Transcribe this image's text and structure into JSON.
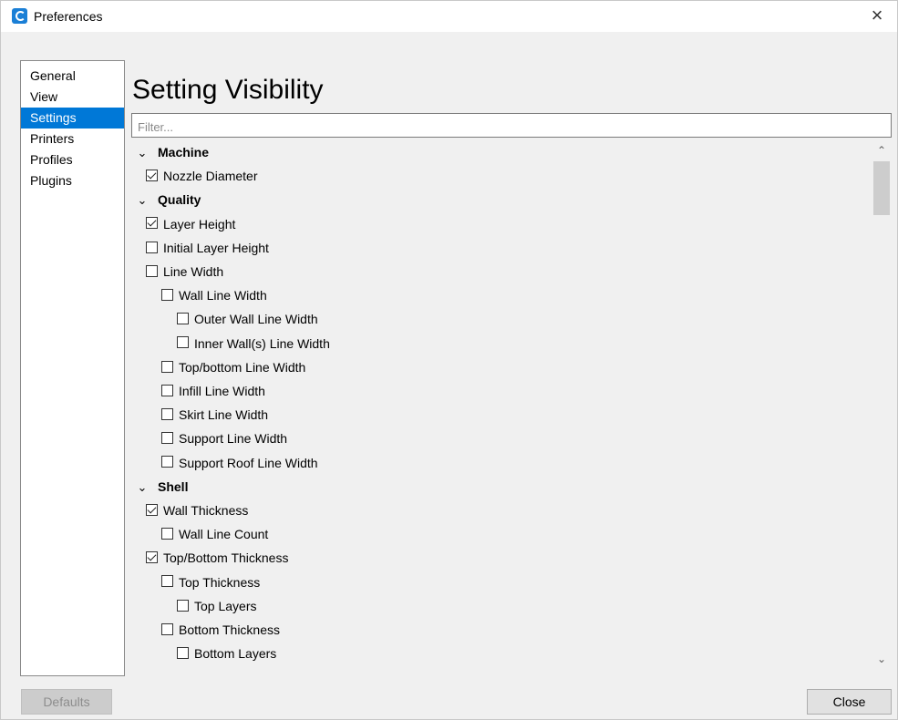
{
  "window": {
    "title": "Preferences",
    "close_glyph": "×"
  },
  "nav": {
    "items": [
      {
        "label": "General",
        "selected": false
      },
      {
        "label": "View",
        "selected": false
      },
      {
        "label": "Settings",
        "selected": true
      },
      {
        "label": "Printers",
        "selected": false
      },
      {
        "label": "Profiles",
        "selected": false
      },
      {
        "label": "Plugins",
        "selected": false
      }
    ]
  },
  "page": {
    "title": "Setting Visibility"
  },
  "filter": {
    "placeholder": "Filter...",
    "value": ""
  },
  "settings": [
    {
      "type": "category",
      "label": "Machine",
      "expanded": true,
      "level": 0
    },
    {
      "type": "setting",
      "label": "Nozzle Diameter",
      "checked": true,
      "level": 0
    },
    {
      "type": "category",
      "label": "Quality",
      "expanded": true,
      "level": 0
    },
    {
      "type": "setting",
      "label": "Layer Height",
      "checked": true,
      "level": 0
    },
    {
      "type": "setting",
      "label": "Initial Layer Height",
      "checked": false,
      "level": 0
    },
    {
      "type": "setting",
      "label": "Line Width",
      "checked": false,
      "level": 0
    },
    {
      "type": "setting",
      "label": "Wall Line Width",
      "checked": false,
      "level": 1
    },
    {
      "type": "setting",
      "label": "Outer Wall Line Width",
      "checked": false,
      "level": 2
    },
    {
      "type": "setting",
      "label": "Inner Wall(s) Line Width",
      "checked": false,
      "level": 2
    },
    {
      "type": "setting",
      "label": "Top/bottom Line Width",
      "checked": false,
      "level": 1
    },
    {
      "type": "setting",
      "label": "Infill Line Width",
      "checked": false,
      "level": 1
    },
    {
      "type": "setting",
      "label": "Skirt Line Width",
      "checked": false,
      "level": 1
    },
    {
      "type": "setting",
      "label": "Support Line Width",
      "checked": false,
      "level": 1
    },
    {
      "type": "setting",
      "label": "Support Roof Line Width",
      "checked": false,
      "level": 1
    },
    {
      "type": "category",
      "label": "Shell",
      "expanded": true,
      "level": 0
    },
    {
      "type": "setting",
      "label": "Wall Thickness",
      "checked": true,
      "level": 0
    },
    {
      "type": "setting",
      "label": "Wall Line Count",
      "checked": false,
      "level": 1
    },
    {
      "type": "setting",
      "label": "Top/Bottom Thickness",
      "checked": true,
      "level": 0
    },
    {
      "type": "setting",
      "label": "Top Thickness",
      "checked": false,
      "level": 1
    },
    {
      "type": "setting",
      "label": "Top Layers",
      "checked": false,
      "level": 2
    },
    {
      "type": "setting",
      "label": "Bottom Thickness",
      "checked": false,
      "level": 1
    },
    {
      "type": "setting",
      "label": "Bottom Layers",
      "checked": false,
      "level": 2
    }
  ],
  "buttons": {
    "defaults_label": "Defaults",
    "defaults_enabled": false,
    "close_label": "Close"
  },
  "icons": {
    "chevron": "chevron-down-icon",
    "scroll_up": "chevron-up-icon",
    "scroll_down": "chevron-down-icon"
  },
  "colors": {
    "selection": "#0078d7",
    "app_icon": "#1a7fd6"
  }
}
